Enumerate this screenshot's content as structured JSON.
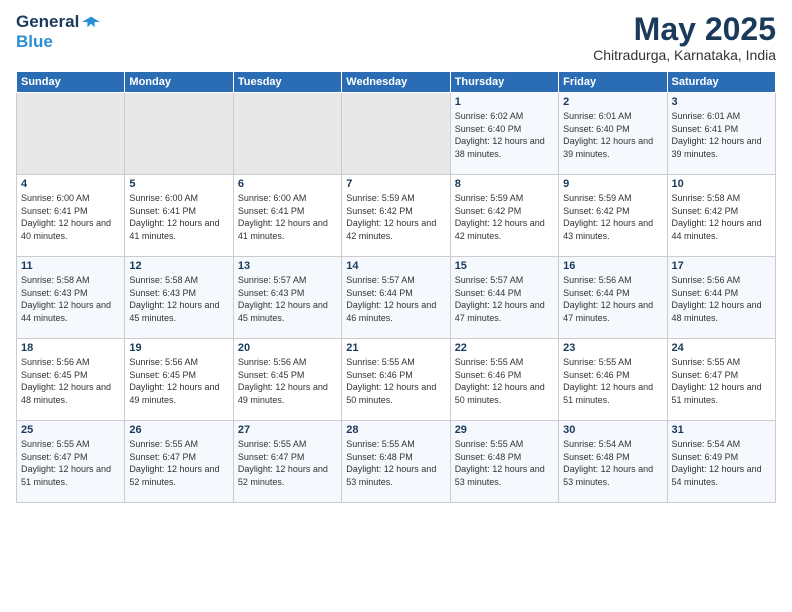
{
  "header": {
    "logo_line1": "General",
    "logo_line2": "Blue",
    "month": "May 2025",
    "location": "Chitradurga, Karnataka, India"
  },
  "weekdays": [
    "Sunday",
    "Monday",
    "Tuesday",
    "Wednesday",
    "Thursday",
    "Friday",
    "Saturday"
  ],
  "weeks": [
    [
      {
        "day": "",
        "empty": true
      },
      {
        "day": "",
        "empty": true
      },
      {
        "day": "",
        "empty": true
      },
      {
        "day": "",
        "empty": true
      },
      {
        "day": "1",
        "sunrise": "6:02 AM",
        "sunset": "6:40 PM",
        "daylight": "12 hours and 38 minutes."
      },
      {
        "day": "2",
        "sunrise": "6:01 AM",
        "sunset": "6:40 PM",
        "daylight": "12 hours and 39 minutes."
      },
      {
        "day": "3",
        "sunrise": "6:01 AM",
        "sunset": "6:41 PM",
        "daylight": "12 hours and 39 minutes."
      }
    ],
    [
      {
        "day": "4",
        "sunrise": "6:00 AM",
        "sunset": "6:41 PM",
        "daylight": "12 hours and 40 minutes."
      },
      {
        "day": "5",
        "sunrise": "6:00 AM",
        "sunset": "6:41 PM",
        "daylight": "12 hours and 41 minutes."
      },
      {
        "day": "6",
        "sunrise": "6:00 AM",
        "sunset": "6:41 PM",
        "daylight": "12 hours and 41 minutes."
      },
      {
        "day": "7",
        "sunrise": "5:59 AM",
        "sunset": "6:42 PM",
        "daylight": "12 hours and 42 minutes."
      },
      {
        "day": "8",
        "sunrise": "5:59 AM",
        "sunset": "6:42 PM",
        "daylight": "12 hours and 42 minutes."
      },
      {
        "day": "9",
        "sunrise": "5:59 AM",
        "sunset": "6:42 PM",
        "daylight": "12 hours and 43 minutes."
      },
      {
        "day": "10",
        "sunrise": "5:58 AM",
        "sunset": "6:42 PM",
        "daylight": "12 hours and 44 minutes."
      }
    ],
    [
      {
        "day": "11",
        "sunrise": "5:58 AM",
        "sunset": "6:43 PM",
        "daylight": "12 hours and 44 minutes."
      },
      {
        "day": "12",
        "sunrise": "5:58 AM",
        "sunset": "6:43 PM",
        "daylight": "12 hours and 45 minutes."
      },
      {
        "day": "13",
        "sunrise": "5:57 AM",
        "sunset": "6:43 PM",
        "daylight": "12 hours and 45 minutes."
      },
      {
        "day": "14",
        "sunrise": "5:57 AM",
        "sunset": "6:44 PM",
        "daylight": "12 hours and 46 minutes."
      },
      {
        "day": "15",
        "sunrise": "5:57 AM",
        "sunset": "6:44 PM",
        "daylight": "12 hours and 47 minutes."
      },
      {
        "day": "16",
        "sunrise": "5:56 AM",
        "sunset": "6:44 PM",
        "daylight": "12 hours and 47 minutes."
      },
      {
        "day": "17",
        "sunrise": "5:56 AM",
        "sunset": "6:44 PM",
        "daylight": "12 hours and 48 minutes."
      }
    ],
    [
      {
        "day": "18",
        "sunrise": "5:56 AM",
        "sunset": "6:45 PM",
        "daylight": "12 hours and 48 minutes."
      },
      {
        "day": "19",
        "sunrise": "5:56 AM",
        "sunset": "6:45 PM",
        "daylight": "12 hours and 49 minutes."
      },
      {
        "day": "20",
        "sunrise": "5:56 AM",
        "sunset": "6:45 PM",
        "daylight": "12 hours and 49 minutes."
      },
      {
        "day": "21",
        "sunrise": "5:55 AM",
        "sunset": "6:46 PM",
        "daylight": "12 hours and 50 minutes."
      },
      {
        "day": "22",
        "sunrise": "5:55 AM",
        "sunset": "6:46 PM",
        "daylight": "12 hours and 50 minutes."
      },
      {
        "day": "23",
        "sunrise": "5:55 AM",
        "sunset": "6:46 PM",
        "daylight": "12 hours and 51 minutes."
      },
      {
        "day": "24",
        "sunrise": "5:55 AM",
        "sunset": "6:47 PM",
        "daylight": "12 hours and 51 minutes."
      }
    ],
    [
      {
        "day": "25",
        "sunrise": "5:55 AM",
        "sunset": "6:47 PM",
        "daylight": "12 hours and 51 minutes."
      },
      {
        "day": "26",
        "sunrise": "5:55 AM",
        "sunset": "6:47 PM",
        "daylight": "12 hours and 52 minutes."
      },
      {
        "day": "27",
        "sunrise": "5:55 AM",
        "sunset": "6:47 PM",
        "daylight": "12 hours and 52 minutes."
      },
      {
        "day": "28",
        "sunrise": "5:55 AM",
        "sunset": "6:48 PM",
        "daylight": "12 hours and 53 minutes."
      },
      {
        "day": "29",
        "sunrise": "5:55 AM",
        "sunset": "6:48 PM",
        "daylight": "12 hours and 53 minutes."
      },
      {
        "day": "30",
        "sunrise": "5:54 AM",
        "sunset": "6:48 PM",
        "daylight": "12 hours and 53 minutes."
      },
      {
        "day": "31",
        "sunrise": "5:54 AM",
        "sunset": "6:49 PM",
        "daylight": "12 hours and 54 minutes."
      }
    ]
  ]
}
